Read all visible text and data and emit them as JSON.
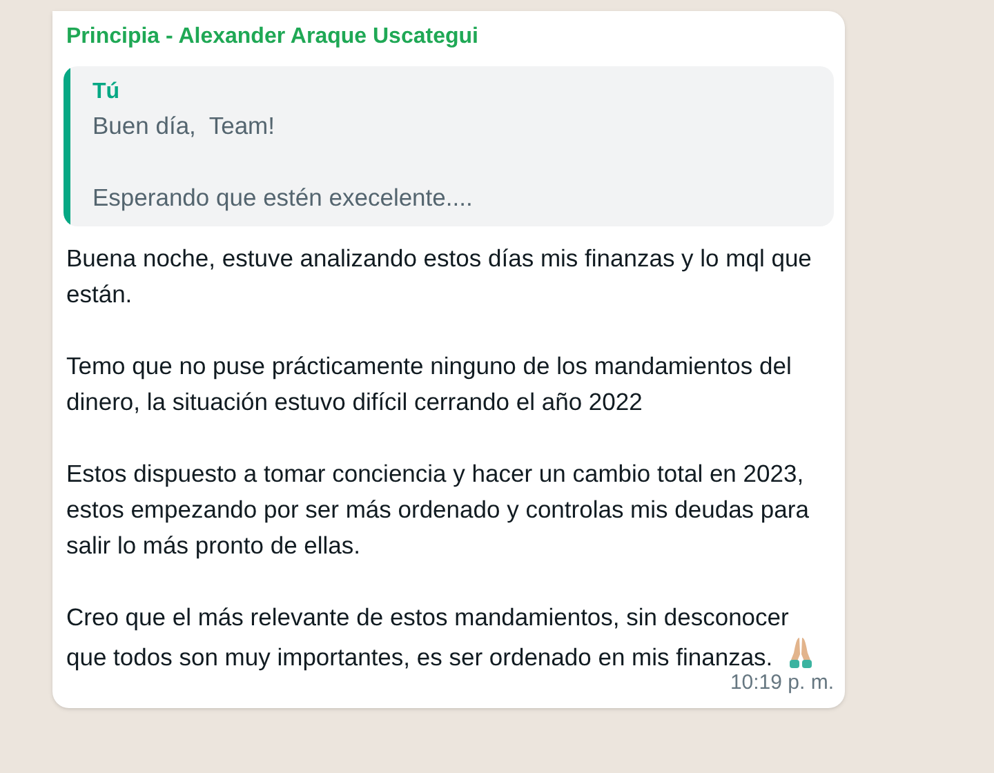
{
  "message": {
    "sender": "Principia - Alexander Araque Uscategui",
    "quote": {
      "author": "Tú",
      "lines": [
        "Buen día,  Team!",
        "Esperando que estén execelente...."
      ]
    },
    "paragraphs": [
      "Buena noche, estuve analizando estos días mis finanzas y lo mql que están.",
      "Temo que no puse prácticamente ninguno de los mandamientos del dinero, la situación estuvo difícil cerrando el año 2022",
      "Estos dispuesto a tomar conciencia y hacer un cambio total en 2023, estos empezando por ser más ordenado y controlas mis deudas para salir lo más pronto de ellas.",
      "Creo que el más relevante de estos mandamientos, sin desconocer que todos son muy importantes, es ser ordenado en mis finanzas."
    ],
    "time": "10:19 p. m."
  }
}
